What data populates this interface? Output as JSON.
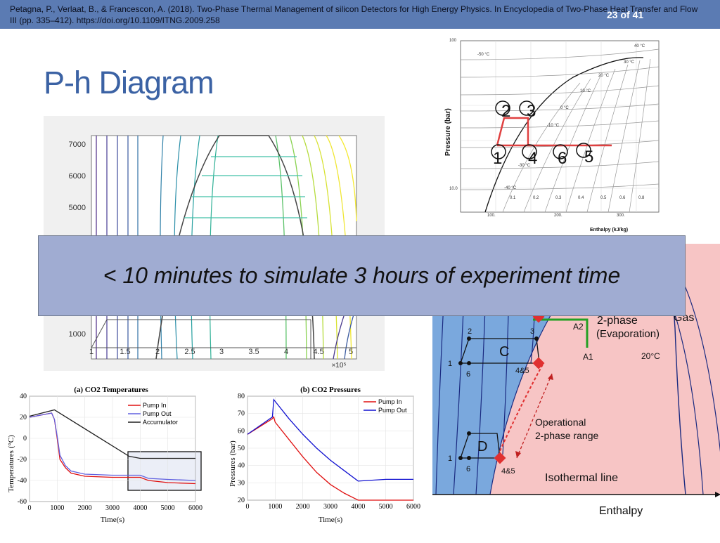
{
  "slide": {
    "citation": "Petagna, P., Verlaat, B., & Francescon, A. (2018). Two-Phase Thermal Management of silicon Detectors for High Energy Physics. In Encyclopedia of Two-Phase Heat Transfer and Flow III (pp. 335–412). https://doi.org/10.1109/ITNG.2009.258",
    "page_number": "23 of 41",
    "title": "P-h Diagram",
    "banner": "< 10 minutes to simulate 3 hours of experiment time",
    "colors": {
      "header": "#5b7bb3",
      "title": "#3b62a4",
      "banner": "#a0acd2"
    }
  },
  "contour_plot": {
    "y_ticks": [
      "7000",
      "6000",
      "5000",
      "1000"
    ],
    "x_ticks": [
      "1",
      "1.5",
      "2",
      "2.5",
      "3",
      "3.5",
      "4",
      "4.5",
      "5"
    ],
    "x_exponent": "×10⁵"
  },
  "ph_diagram": {
    "ylabel": "Pressure (bar)",
    "xlabel": "Enthalpy (kJ/kg)",
    "y_ticks": [
      "100",
      "10.0"
    ],
    "x_ticks": [
      "100.",
      "200.",
      "300."
    ],
    "quality_labels": [
      "0.1",
      "0.2",
      "0.3",
      "0.4",
      "0.5",
      "0.6",
      "0.8"
    ],
    "isotherm_labels": [
      "40 °C",
      "30 °C",
      "20 °C",
      "10 °C",
      "0 °C",
      "-10 °C",
      "-30 °C",
      "-40 °C",
      "-50 °C"
    ],
    "points": [
      "1",
      "2",
      "3",
      "4",
      "5",
      "6"
    ]
  },
  "cycle_diagram": {
    "labels": {
      "gas": "Gas",
      "two_phase": "2-phase",
      "evaporation": "(Evaporation)",
      "a1": "A1",
      "a2": "A2",
      "temp": "20°C",
      "c": "C",
      "d": "D",
      "operational": "Operational",
      "range": "2-phase range",
      "isothermal": "Isothermal line",
      "enthalpy": "Enthalpy",
      "p2": "2",
      "p3": "3",
      "p1_c": "1",
      "p6_c": "6",
      "p45_c": "4&5",
      "p1_d": "1",
      "p6_d": "6",
      "p45_d": "4&5"
    }
  },
  "chart_data": [
    {
      "type": "line",
      "title": "(a) CO2 Temperatures",
      "xlabel": "Time(s)",
      "ylabel": "Temperatures (°C)",
      "xlim": [
        0,
        6000
      ],
      "ylim": [
        -60,
        40
      ],
      "x_ticks": [
        0,
        1000,
        2000,
        3000,
        4000,
        5000,
        6000
      ],
      "y_ticks": [
        -60,
        -40,
        -20,
        0,
        20,
        40
      ],
      "colors": [
        "#e01010",
        "#6060e0",
        "#202020"
      ],
      "series": [
        {
          "name": "Pump In",
          "x": [
            0,
            400,
            800,
            900,
            1000,
            1100,
            1300,
            1500,
            2000,
            3000,
            4000,
            4300,
            5000,
            6000
          ],
          "y": [
            20,
            22,
            24,
            18,
            0,
            -20,
            -28,
            -33,
            -36,
            -37,
            -37,
            -40,
            -42,
            -43
          ]
        },
        {
          "name": "Pump Out",
          "x": [
            0,
            400,
            800,
            900,
            1000,
            1100,
            1300,
            1500,
            2000,
            3000,
            4000,
            4300,
            5000,
            6000
          ],
          "y": [
            20,
            22,
            24,
            18,
            2,
            -16,
            -26,
            -31,
            -34,
            -35,
            -35,
            -38,
            -39,
            -40
          ]
        },
        {
          "name": "Accumulator",
          "x": [
            0,
            900,
            3600,
            4000,
            5000,
            6000
          ],
          "y": [
            21,
            27,
            -17,
            -19,
            -19,
            -19
          ]
        }
      ]
    },
    {
      "type": "line",
      "title": "(b) CO2 Pressures",
      "xlabel": "Time(s)",
      "ylabel": "Pressures (bar)",
      "xlim": [
        0,
        6000
      ],
      "ylim": [
        20,
        80
      ],
      "x_ticks": [
        0,
        1000,
        2000,
        3000,
        4000,
        5000,
        6000
      ],
      "y_ticks": [
        20,
        30,
        40,
        50,
        60,
        70,
        80
      ],
      "colors": [
        "#e01010",
        "#1010d0"
      ],
      "series": [
        {
          "name": "Pump In",
          "x": [
            0,
            900,
            950,
            1000,
            1500,
            2000,
            2500,
            3000,
            3500,
            4000,
            5000,
            6000
          ],
          "y": [
            58,
            67,
            68,
            65,
            55,
            45,
            36,
            29,
            24,
            20,
            20,
            20
          ]
        },
        {
          "name": "Pump Out",
          "x": [
            0,
            900,
            950,
            1000,
            1500,
            2000,
            2500,
            3000,
            3500,
            4000,
            5000,
            6000
          ],
          "y": [
            58,
            68,
            78,
            77,
            67,
            58,
            50,
            43,
            37,
            31,
            32,
            32
          ]
        }
      ]
    }
  ]
}
